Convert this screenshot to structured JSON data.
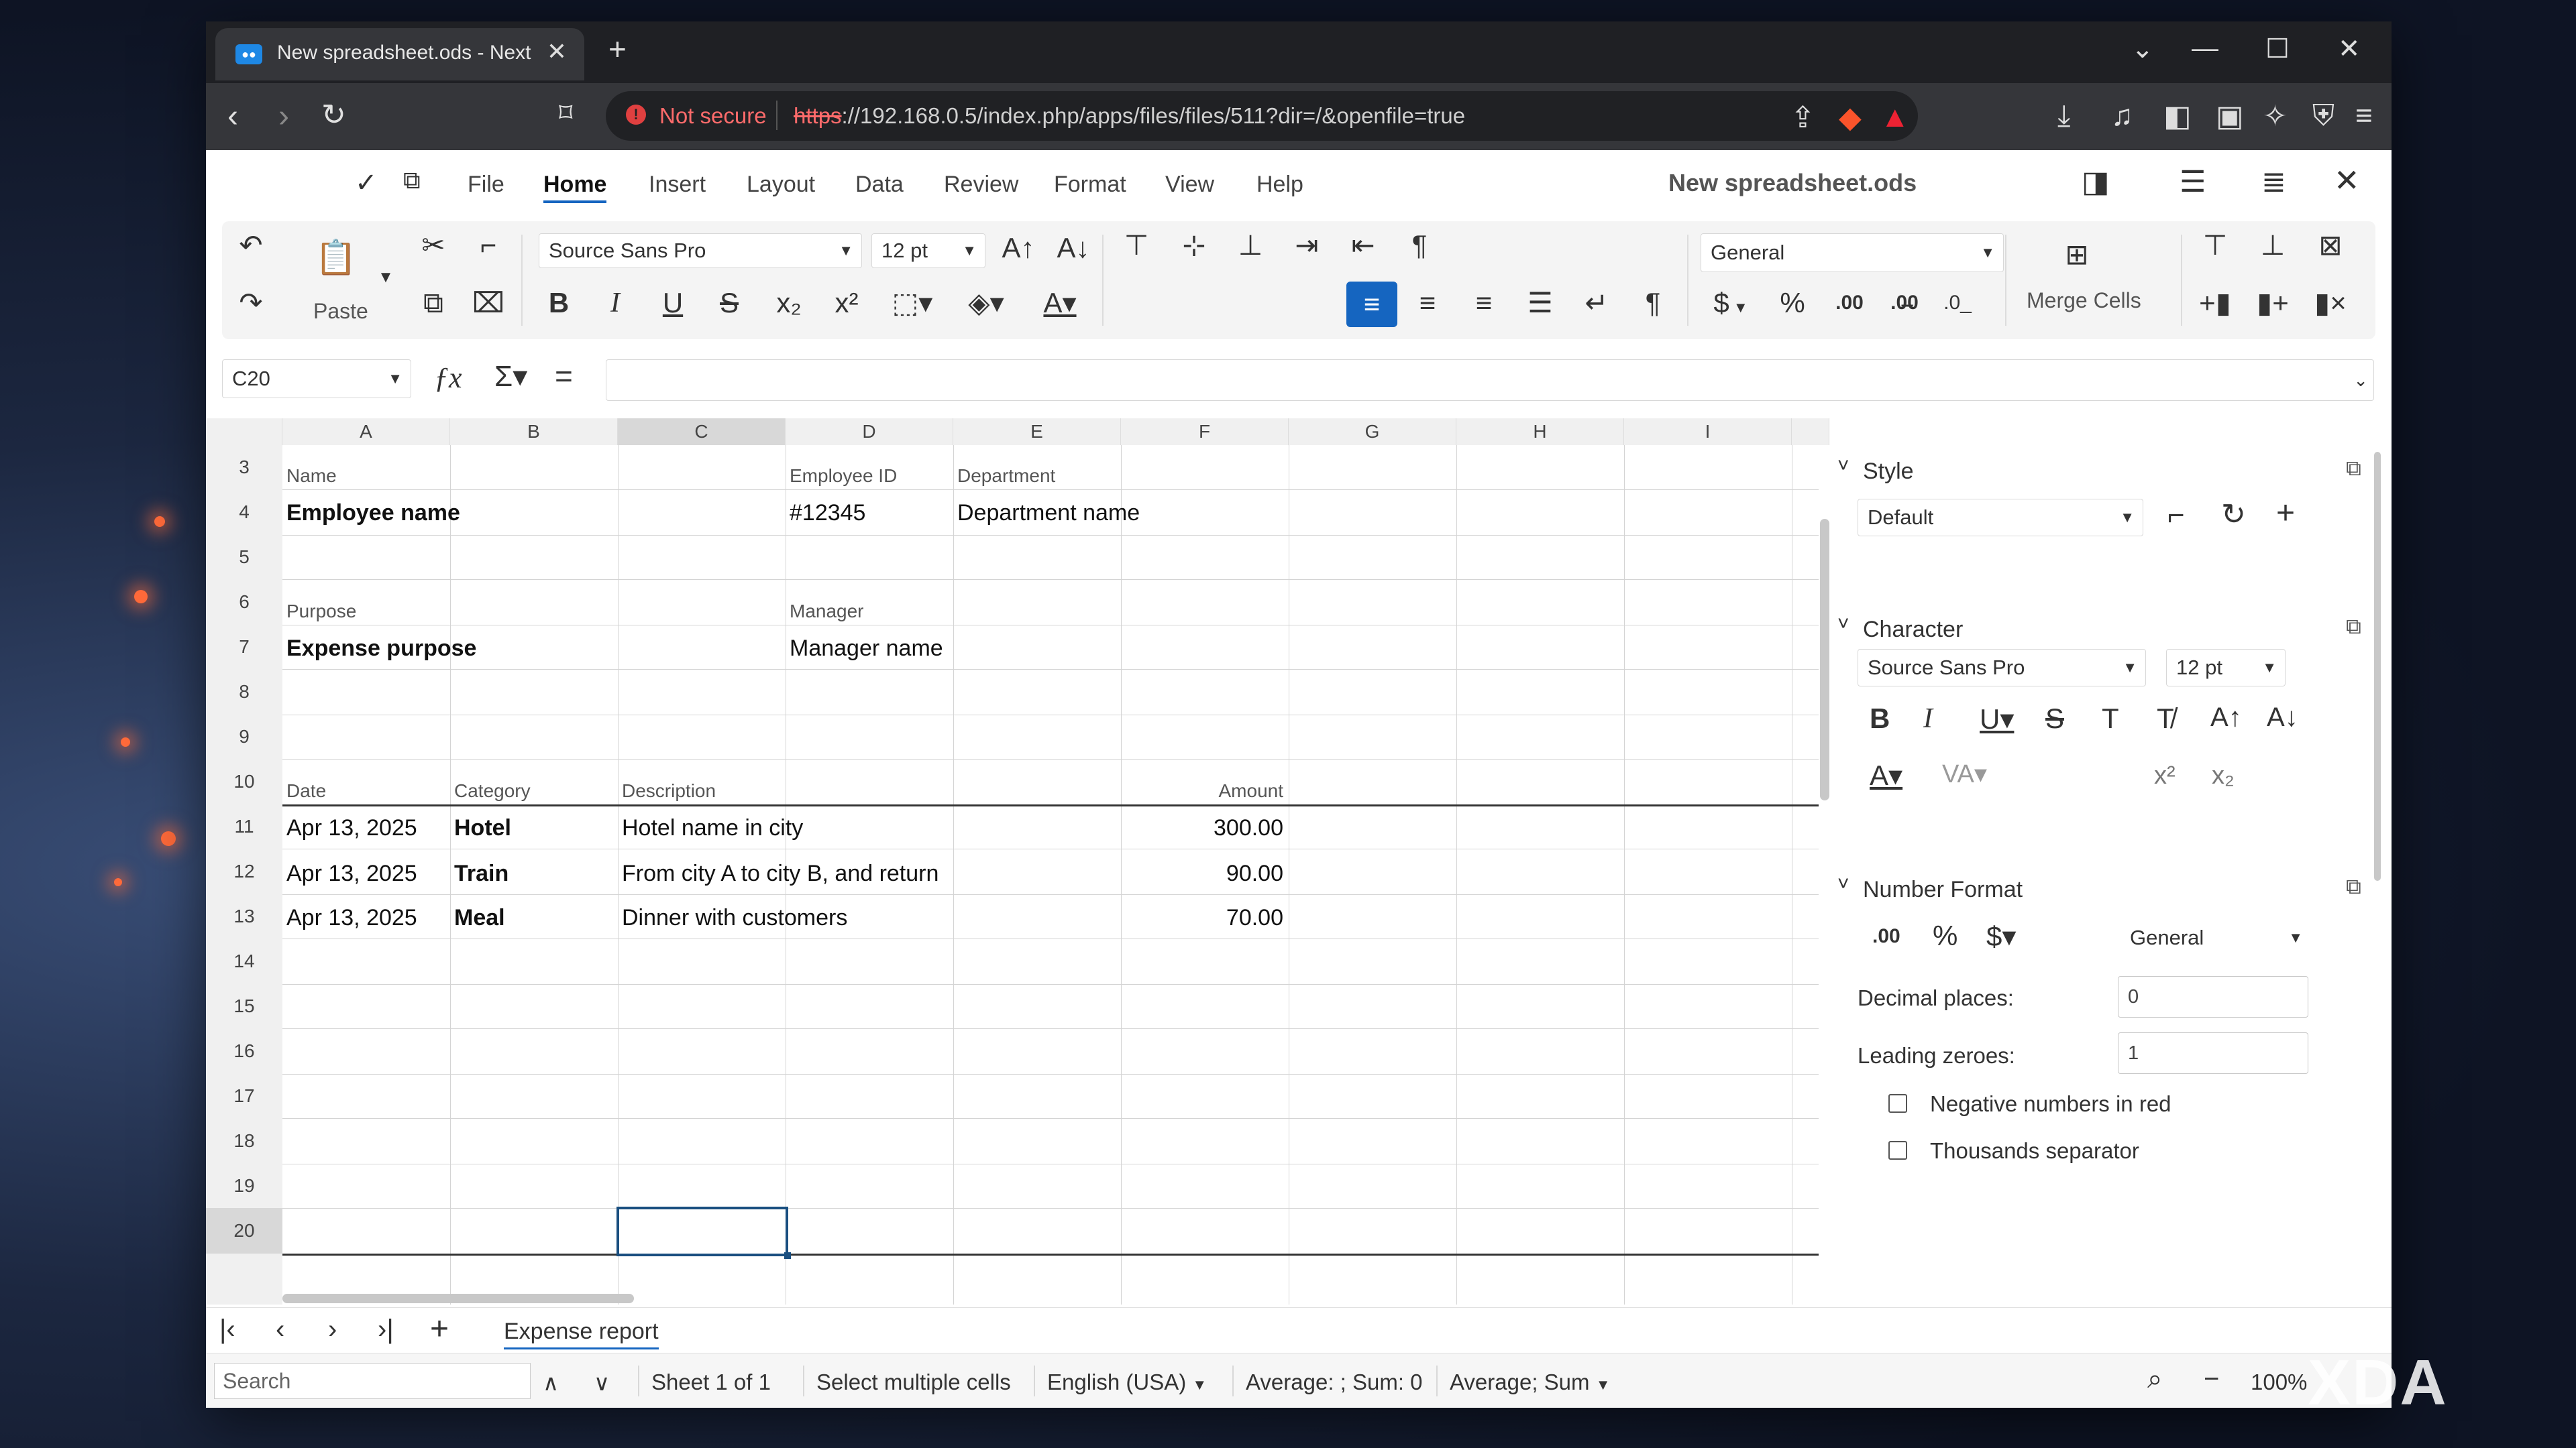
{
  "browser": {
    "tab_title": "New spreadsheet.ods - NextClo",
    "not_secure": "Not secure",
    "url_scheme": "https",
    "url_rest": "://192.168.0.5/index.php/apps/files/files/511?dir=/&openfile=true"
  },
  "menu": [
    "File",
    "Home",
    "Insert",
    "Layout",
    "Data",
    "Review",
    "Format",
    "View",
    "Help"
  ],
  "menu_active": "Home",
  "doc_title": "New spreadsheet.ods",
  "ribbon": {
    "paste_label": "Paste",
    "font_name": "Source Sans Pro",
    "font_size": "12 pt",
    "number_format": "General",
    "merge_label": "Merge Cells",
    "conditional_label": "Conditional",
    "currency_symbol": "$",
    "percent_symbol": "%",
    "decimal_symbol": ".00"
  },
  "formula": {
    "cell_ref": "C20",
    "content": ""
  },
  "columns": [
    "A",
    "B",
    "C",
    "D",
    "E",
    "F",
    "G",
    "H",
    "I"
  ],
  "selected_column": "C",
  "rows": [
    "3",
    "4",
    "5",
    "6",
    "7",
    "8",
    "9",
    "10",
    "11",
    "12",
    "13",
    "14",
    "15",
    "16",
    "17",
    "18",
    "19",
    "20"
  ],
  "selected_row": "20",
  "cells": {
    "A3": "Name",
    "D3": "Employee ID",
    "E3": "Department",
    "A4": "Employee name",
    "D4": "#12345",
    "E4": "Department name",
    "A6": "Purpose",
    "D6": "Manager",
    "A7": "Expense purpose",
    "D7": "Manager name",
    "A10": "Date",
    "B10": "Category",
    "C10": "Description",
    "F10": "Amount",
    "rows": [
      {
        "date": "Apr 13, 2025",
        "category": "Hotel",
        "description": "Hotel name in city",
        "amount": "300.00"
      },
      {
        "date": "Apr 13, 2025",
        "category": "Train",
        "description": "From city A to city B, and return",
        "amount": "90.00"
      },
      {
        "date": "Apr 13, 2025",
        "category": "Meal",
        "description": "Dinner with customers",
        "amount": "70.00"
      }
    ]
  },
  "sidebar": {
    "style_title": "Style",
    "style_value": "Default",
    "character_title": "Character",
    "char_font": "Source Sans Pro",
    "char_size": "12 pt",
    "number_title": "Number Format",
    "number_value": "General",
    "decimal_label": "Decimal places:",
    "decimal_value": "0",
    "leading_label": "Leading zeroes:",
    "leading_value": "1",
    "negative_red": "Negative numbers in red",
    "thousands": "Thousands separator"
  },
  "sheet_tab": "Expense report",
  "status": {
    "search_placeholder": "Search",
    "sheet": "Sheet 1 of 1",
    "mode": "Select multiple cells",
    "language": "English (USA)",
    "summary": "Average: ; Sum: 0",
    "summary_mode": "Average; Sum",
    "zoom": "100%"
  },
  "watermark": "XDA",
  "colors": {
    "accent": "#1565c0",
    "selection_border": "#1a4f80",
    "danger": "#ff6b6b"
  }
}
